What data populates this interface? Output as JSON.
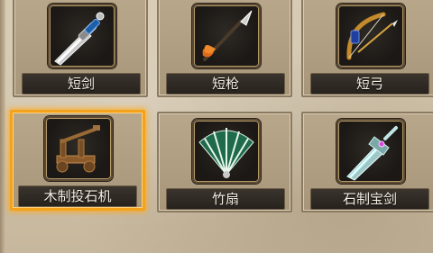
{
  "inventory": {
    "items": [
      {
        "label": "短剑",
        "icon": "short-sword-icon"
      },
      {
        "label": "短枪",
        "icon": "short-spear-icon"
      },
      {
        "label": "短弓",
        "icon": "short-bow-icon"
      },
      {
        "label": "木制投石机",
        "icon": "wooden-catapult-icon",
        "selected": true
      },
      {
        "label": "竹扇",
        "icon": "bamboo-fan-icon"
      },
      {
        "label": "石制宝剑",
        "icon": "stone-sword-icon"
      }
    ]
  },
  "colors": {
    "selection_glow": "#f2a21b",
    "label_text": "#f4efe4",
    "label_bar": "#2b251f"
  }
}
